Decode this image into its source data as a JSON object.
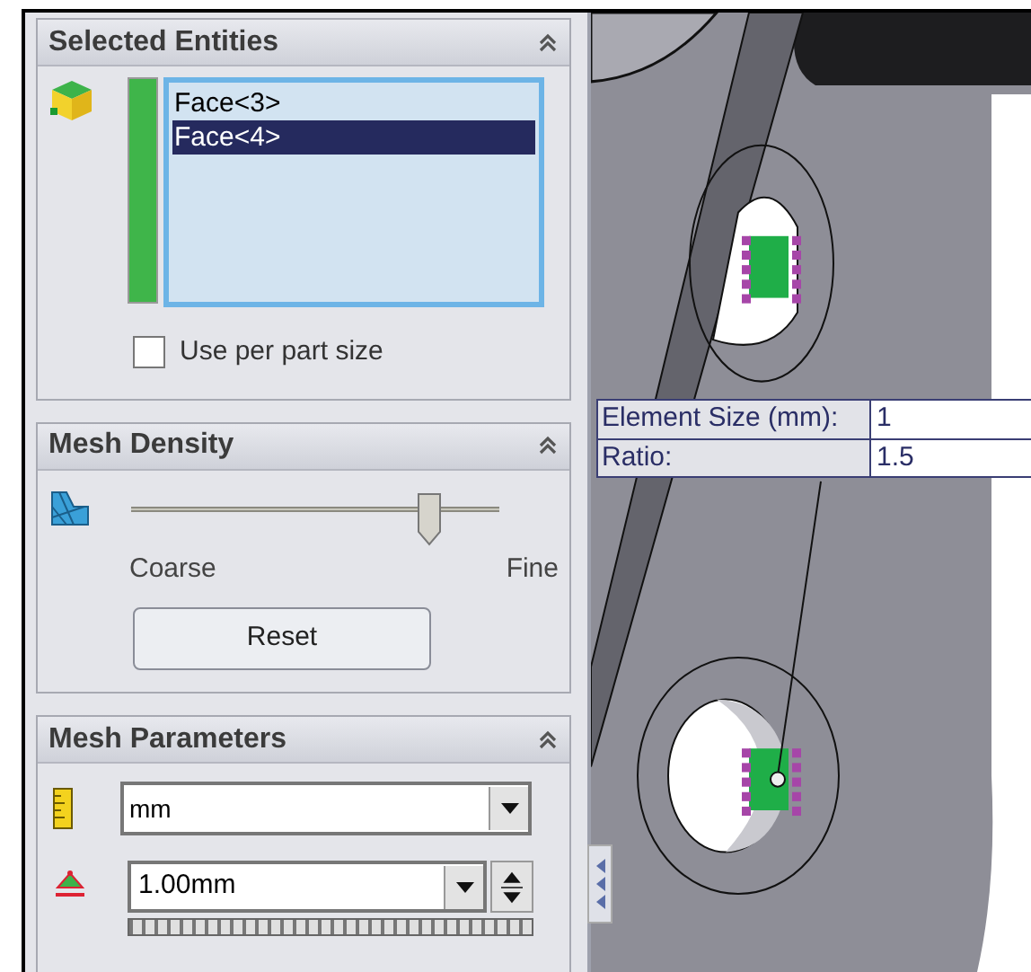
{
  "selected_entities": {
    "title": "Selected Entities",
    "items": [
      {
        "label": "Face<3>",
        "selected": false
      },
      {
        "label": "Face<4>",
        "selected": true
      }
    ],
    "use_per_part_size": {
      "label": "Use per part size",
      "checked": false
    }
  },
  "mesh_density": {
    "title": "Mesh Density",
    "slider": {
      "level": 0.81
    },
    "min_label": "Coarse",
    "max_label": "Fine",
    "reset_button": "Reset"
  },
  "mesh_parameters": {
    "title": "Mesh Parameters",
    "unit_dropdown": {
      "value": "mm"
    },
    "size_field": {
      "value": "1.00mm"
    }
  },
  "element_callout": {
    "rows": [
      {
        "label": "Element Size (mm):",
        "value": "1"
      },
      {
        "label": "Ratio:",
        "value": "1.5"
      }
    ]
  }
}
